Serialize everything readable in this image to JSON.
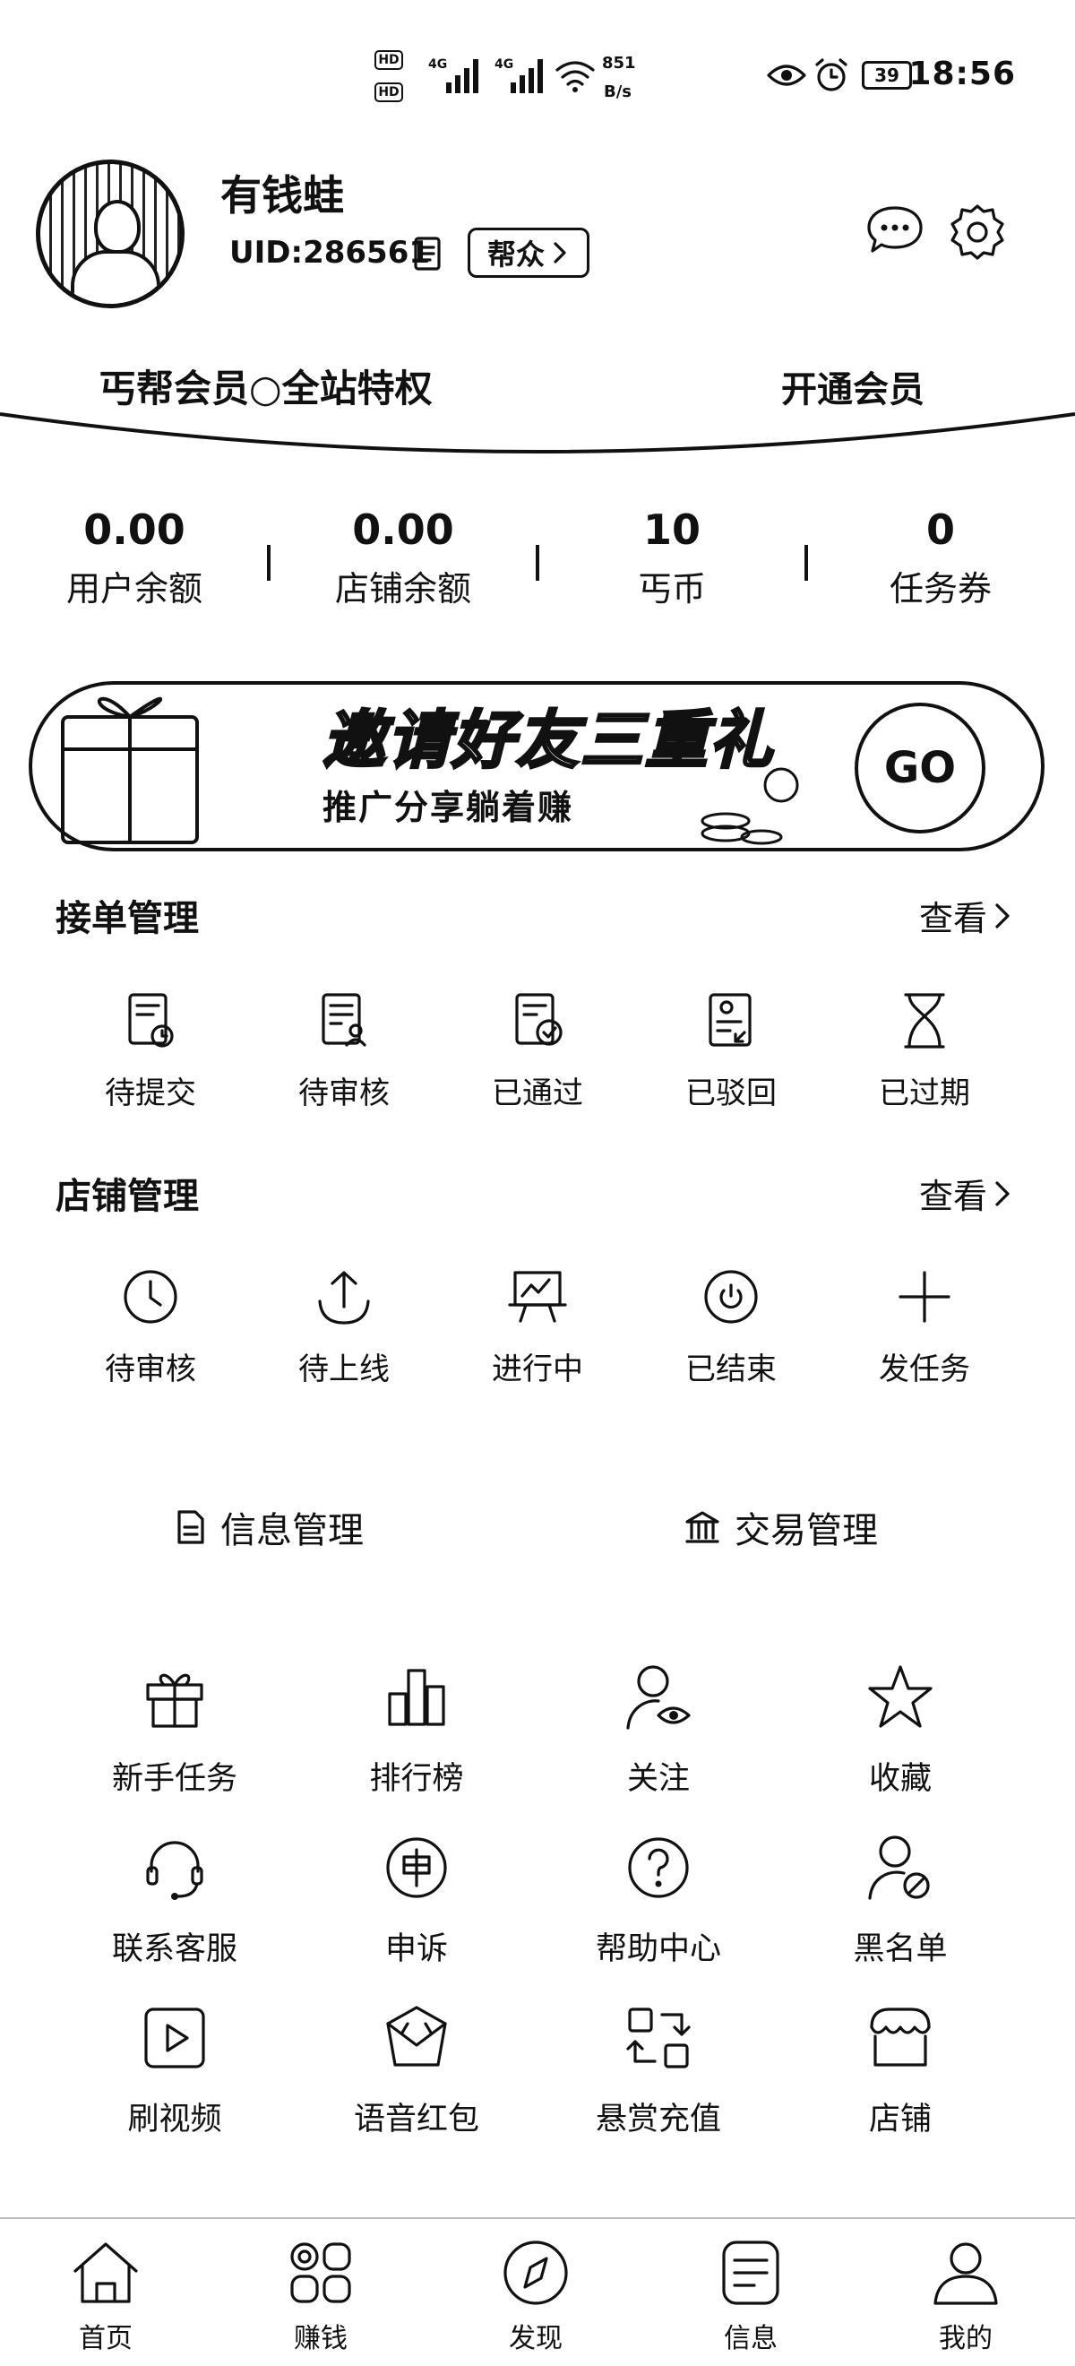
{
  "status_bar": {
    "hd1": "HD",
    "hd2": "HD",
    "net1": "4G",
    "net2": "4G",
    "speed_value": "851",
    "speed_unit": "B/s",
    "battery": "39",
    "time": "18:56"
  },
  "profile": {
    "name": "有钱蛙",
    "uid": "UID:286561",
    "tag": "帮众"
  },
  "member": {
    "title": "丐帮会员○全站特权",
    "action": "开通会员"
  },
  "stats": [
    {
      "value": "0.00",
      "label": "用户余额"
    },
    {
      "value": "0.00",
      "label": "店铺余额"
    },
    {
      "value": "10",
      "label": "丐币"
    },
    {
      "value": "0",
      "label": "任务券"
    }
  ],
  "banner": {
    "title": "邀请好友三重礼",
    "subtitle": "推广分享躺着赚",
    "go": "GO"
  },
  "order_section": {
    "title": "接单管理",
    "more": "查看",
    "items": [
      {
        "label": "待提交",
        "icon": "doc-clock-icon"
      },
      {
        "label": "待审核",
        "icon": "doc-user-icon"
      },
      {
        "label": "已通过",
        "icon": "doc-check-icon"
      },
      {
        "label": "已驳回",
        "icon": "doc-return-icon"
      },
      {
        "label": "已过期",
        "icon": "hourglass-icon"
      }
    ]
  },
  "shop_section": {
    "title": "店铺管理",
    "more": "查看",
    "items": [
      {
        "label": "待审核",
        "icon": "clock-icon"
      },
      {
        "label": "待上线",
        "icon": "upload-icon"
      },
      {
        "label": "进行中",
        "icon": "presentation-icon"
      },
      {
        "label": "已结束",
        "icon": "power-icon"
      },
      {
        "label": "发任务",
        "icon": "plus-icon"
      }
    ]
  },
  "management": {
    "info": "信息管理",
    "trade": "交易管理"
  },
  "tools": [
    {
      "label": "新手任务",
      "icon": "gift-icon"
    },
    {
      "label": "排行榜",
      "icon": "bar-chart-icon"
    },
    {
      "label": "关注",
      "icon": "user-eye-icon"
    },
    {
      "label": "收藏",
      "icon": "star-icon"
    },
    {
      "label": "联系客服",
      "icon": "headset-icon"
    },
    {
      "label": "申诉",
      "icon": "appeal-icon"
    },
    {
      "label": "帮助中心",
      "icon": "question-icon"
    },
    {
      "label": "黑名单",
      "icon": "user-block-icon"
    },
    {
      "label": "刷视频",
      "icon": "video-icon"
    },
    {
      "label": "语音红包",
      "icon": "envelope-icon"
    },
    {
      "label": "悬赏充值",
      "icon": "exchange-icon"
    },
    {
      "label": "店铺",
      "icon": "shop-icon"
    }
  ],
  "nav": [
    {
      "label": "首页",
      "icon": "home-icon"
    },
    {
      "label": "赚钱",
      "icon": "grid-icon"
    },
    {
      "label": "发现",
      "icon": "compass-icon"
    },
    {
      "label": "信息",
      "icon": "message-icon"
    },
    {
      "label": "我的",
      "icon": "person-icon"
    }
  ]
}
